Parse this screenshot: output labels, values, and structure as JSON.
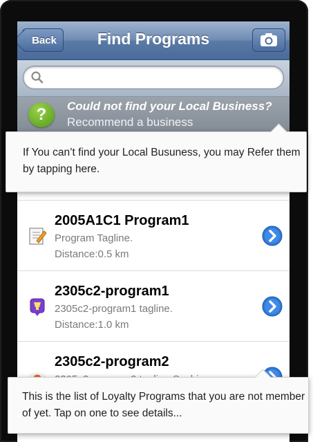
{
  "navbar": {
    "back_label": "Back",
    "title": "Find Programs",
    "camera_icon": "camera-icon"
  },
  "search": {
    "value": "",
    "placeholder": "",
    "icon": "search-icon"
  },
  "recommend": {
    "icon": "question-icon",
    "title": "Could not find your Local Business?",
    "subtitle": "Recommend a business"
  },
  "programs": [
    {
      "title": "2005A1C1 Program1",
      "tagline": "Program Tagline.",
      "distance": "Distance:0.5 km",
      "icon": "notepad-pencil-icon"
    },
    {
      "title": "2305c2-program1",
      "tagline": "2305c2-program1 tagline.",
      "distance": "Distance:1.0 km",
      "icon": "trophy-badge-icon"
    },
    {
      "title": "2305c2-program2",
      "tagline": "2305c2-program2 tagline Sushi",
      "distance": "",
      "icon": "sushi-icon"
    }
  ],
  "tooltips": {
    "recommend_hint": "If You can’t find your Local Busuness, you may Refer them by tapping here.",
    "list_hint": "This is the list of Loyalty Programs that you are not member of yet. Tap on one to see details..."
  },
  "colors": {
    "navbar": "#6f8cb4",
    "disclosure": "#2f78d6",
    "recommend_icon": "#6fb52c"
  }
}
